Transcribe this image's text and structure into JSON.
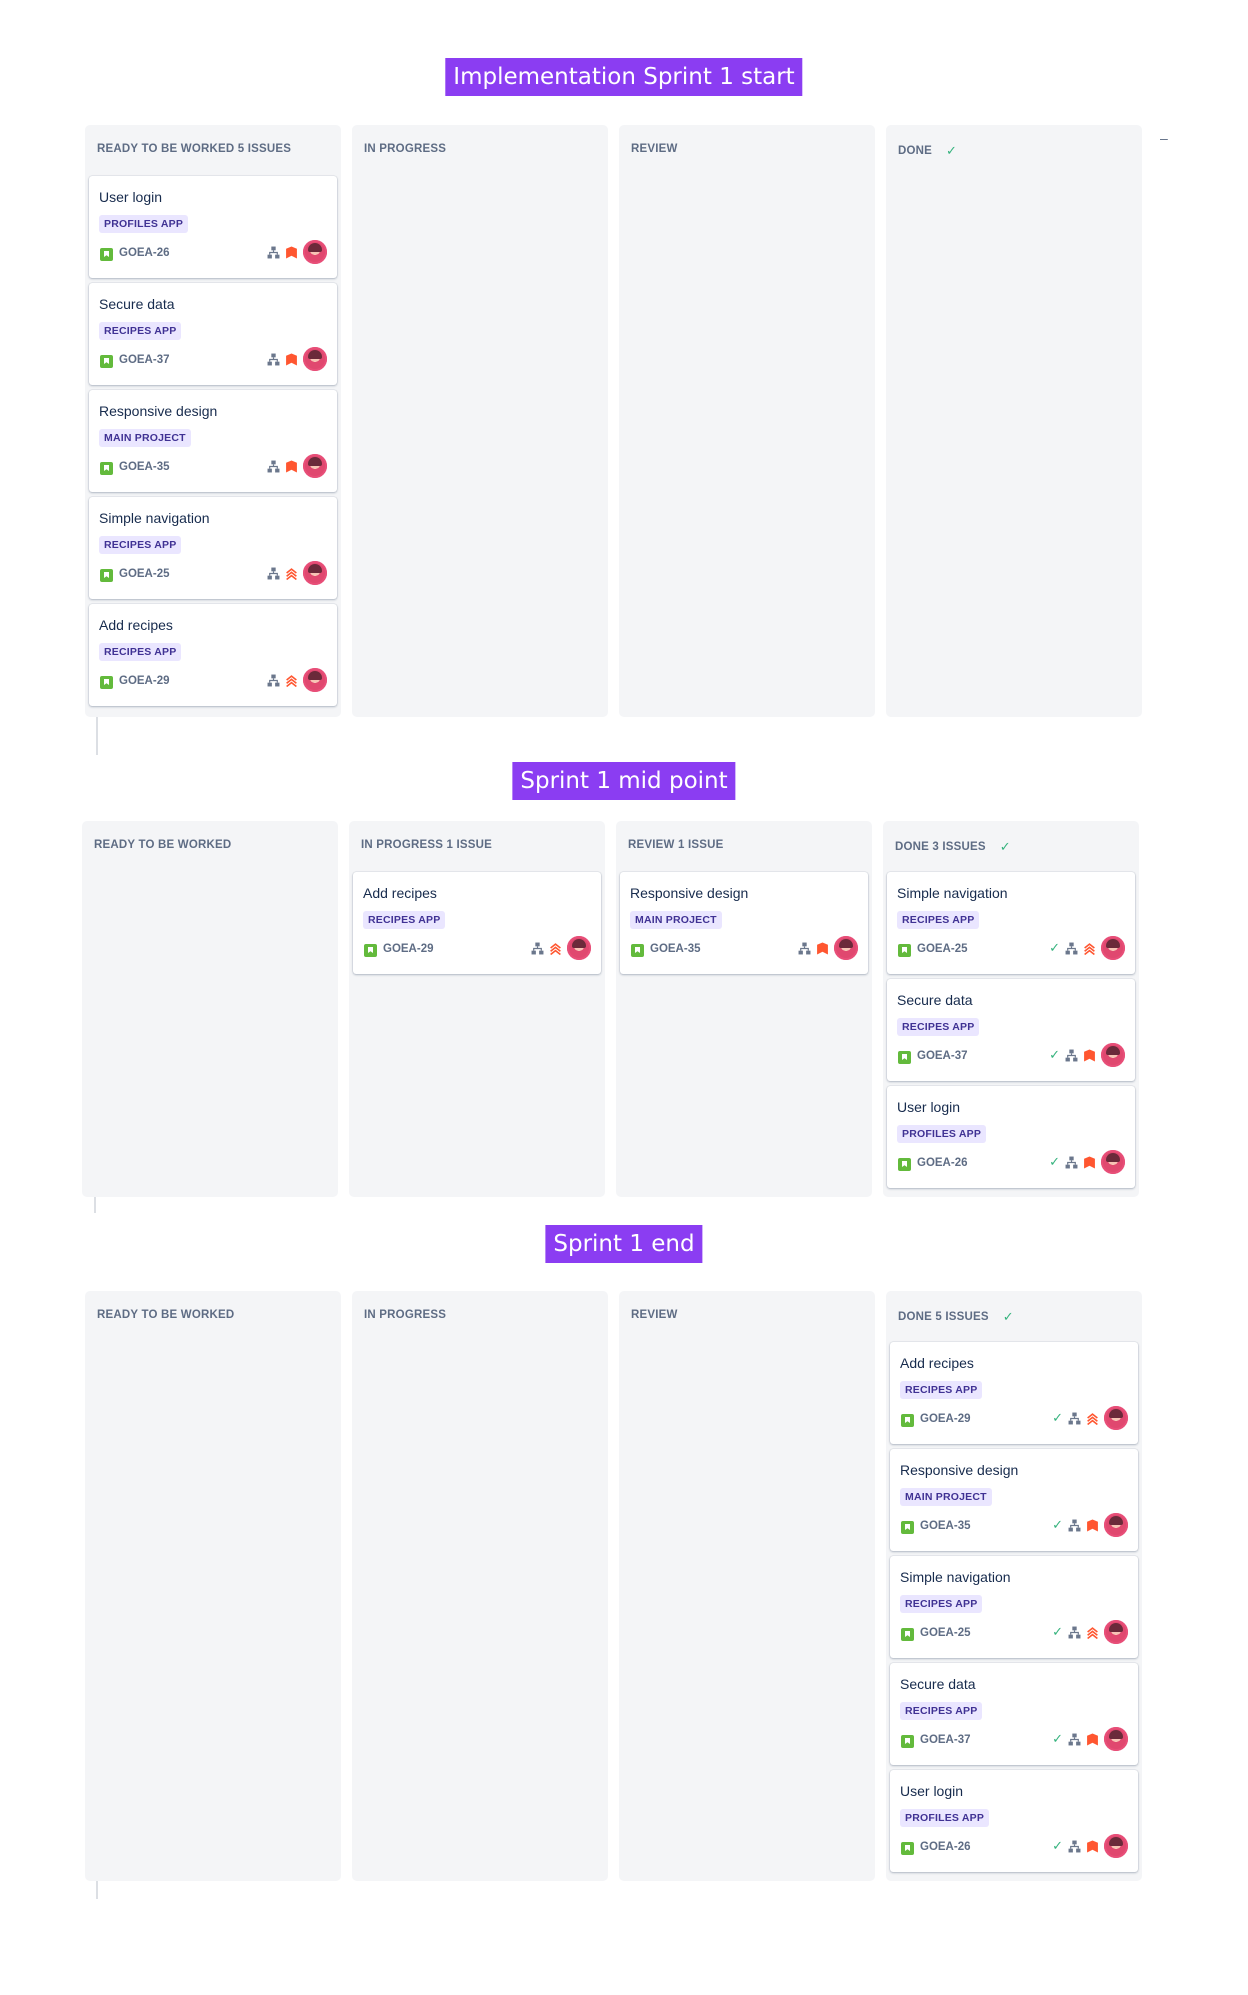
{
  "colors": {
    "banner_bg": "#8b3df2",
    "column_bg": "#f4f5f7",
    "epic_bg": "#eae6ff",
    "epic_text": "#403294",
    "story_green": "#63ba3c",
    "done_check": "#36b37e",
    "priority_orange": "#ff5630"
  },
  "sections": [
    {
      "banner": "Implementation Sprint 1 start",
      "columns": [
        {
          "header": "READY TO BE WORKED 5 ISSUES",
          "check": false,
          "cards": [
            {
              "title": "User login",
              "epic": "PROFILES APP",
              "key": "GOEA-26",
              "priority": "high",
              "done": false
            },
            {
              "title": "Secure data",
              "epic": "RECIPES APP",
              "key": "GOEA-37",
              "priority": "high",
              "done": false
            },
            {
              "title": "Responsive design",
              "epic": "MAIN PROJECT",
              "key": "GOEA-35",
              "priority": "high",
              "done": false
            },
            {
              "title": "Simple navigation",
              "epic": "RECIPES APP",
              "key": "GOEA-25",
              "priority": "highest",
              "done": false
            },
            {
              "title": "Add recipes",
              "epic": "RECIPES APP",
              "key": "GOEA-29",
              "priority": "highest",
              "done": false
            }
          ]
        },
        {
          "header": "IN PROGRESS",
          "check": false,
          "cards": []
        },
        {
          "header": "REVIEW",
          "check": false,
          "cards": []
        },
        {
          "header": "DONE",
          "check": true,
          "cards": []
        }
      ],
      "edge_mark": "–"
    },
    {
      "banner": "Sprint 1 mid point",
      "columns": [
        {
          "header": "READY TO BE WORKED",
          "check": false,
          "cards": []
        },
        {
          "header": "IN PROGRESS 1 ISSUE",
          "check": false,
          "cards": [
            {
              "title": "Add recipes",
              "epic": "RECIPES APP",
              "key": "GOEA-29",
              "priority": "highest",
              "done": false
            }
          ]
        },
        {
          "header": "REVIEW 1 ISSUE",
          "check": false,
          "cards": [
            {
              "title": "Responsive design",
              "epic": "MAIN PROJECT",
              "key": "GOEA-35",
              "priority": "high",
              "done": false
            }
          ]
        },
        {
          "header": "DONE 3 ISSUES",
          "check": true,
          "cards": [
            {
              "title": "Simple navigation",
              "epic": "RECIPES APP",
              "key": "GOEA-25",
              "priority": "highest",
              "done": true
            },
            {
              "title": "Secure data",
              "epic": "RECIPES APP",
              "key": "GOEA-37",
              "priority": "high",
              "done": true
            },
            {
              "title": "User login",
              "epic": "PROFILES APP",
              "key": "GOEA-26",
              "priority": "high",
              "done": true
            }
          ]
        }
      ],
      "edge_mark": ""
    },
    {
      "banner": "Sprint 1 end",
      "columns": [
        {
          "header": "READY TO BE WORKED",
          "check": false,
          "cards": []
        },
        {
          "header": "IN PROGRESS",
          "check": false,
          "cards": []
        },
        {
          "header": "REVIEW",
          "check": false,
          "cards": []
        },
        {
          "header": "DONE 5 ISSUES",
          "check": true,
          "cards": [
            {
              "title": "Add recipes",
              "epic": "RECIPES APP",
              "key": "GOEA-29",
              "priority": "highest",
              "done": true
            },
            {
              "title": "Responsive design",
              "epic": "MAIN PROJECT",
              "key": "GOEA-35",
              "priority": "high",
              "done": true
            },
            {
              "title": "Simple navigation",
              "epic": "RECIPES APP",
              "key": "GOEA-25",
              "priority": "highest",
              "done": true
            },
            {
              "title": "Secure data",
              "epic": "RECIPES APP",
              "key": "GOEA-37",
              "priority": "high",
              "done": true
            },
            {
              "title": "User login",
              "epic": "PROFILES APP",
              "key": "GOEA-26",
              "priority": "high",
              "done": true
            }
          ]
        }
      ],
      "edge_mark": ""
    }
  ]
}
